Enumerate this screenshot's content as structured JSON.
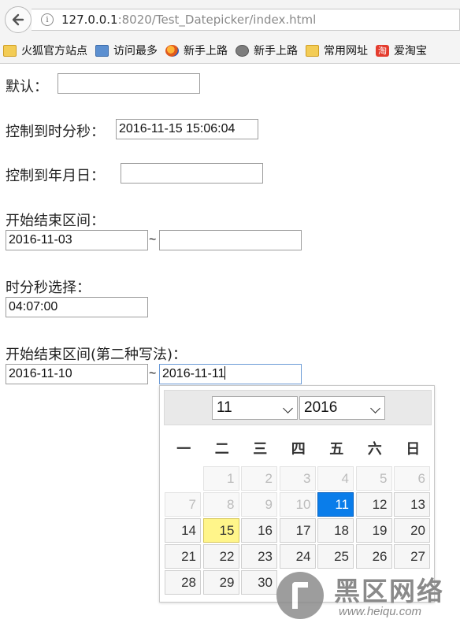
{
  "browser": {
    "url_host": "127.0.0.1",
    "url_rest": ":8020/Test_Datepicker/index.html",
    "info_glyph": "i",
    "bookmarks": [
      {
        "label": "火狐官方站点",
        "icon": "folder-icon"
      },
      {
        "label": "访问最多",
        "icon": "bookmark-book-icon"
      },
      {
        "label": "新手上路",
        "icon": "firefox-icon"
      },
      {
        "label": "新手上路",
        "icon": "globe-icon"
      },
      {
        "label": "常用网址",
        "icon": "folder-icon"
      },
      {
        "label": "爱淘宝",
        "icon": "taobao-icon",
        "glyph": "淘"
      }
    ]
  },
  "form": {
    "default_label": "默认：",
    "default_value": "",
    "datetime_label": "控制到时分秒：",
    "datetime_value": "2016-11-15 15:06:04",
    "date_label": "控制到年月日：",
    "date_value": "",
    "range_label": "开始结束区间：",
    "range_start": "2016-11-03",
    "range_end": "",
    "time_label": "时分秒选择：",
    "time_value": "04:07:00",
    "range2_label": "开始结束区间(第二种写法)：",
    "range2_start": "2016-11-10",
    "range2_end": "2016-11-11",
    "separator": "~"
  },
  "datepicker": {
    "month_value": "11",
    "year_value": "2016",
    "weekdays": [
      "一",
      "二",
      "三",
      "四",
      "五",
      "六",
      "日"
    ],
    "weeks": [
      [
        null,
        "1",
        "2",
        "3",
        "4",
        "5",
        "6"
      ],
      [
        "7",
        "8",
        "9",
        "10",
        "11",
        "12",
        "13"
      ],
      [
        "14",
        "15",
        "16",
        "17",
        "18",
        "19",
        "20"
      ],
      [
        "21",
        "22",
        "23",
        "24",
        "25",
        "26",
        "27"
      ],
      [
        "28",
        "29",
        "30",
        null,
        null,
        null,
        null
      ]
    ],
    "disabled_days": [
      "1",
      "2",
      "3",
      "4",
      "5",
      "6",
      "7",
      "8",
      "9",
      "10"
    ],
    "selected_day": "11",
    "today_day": "15",
    "colors": {
      "selected": "#0a7dea",
      "today": "#fff58a"
    }
  },
  "watermark": {
    "cn_text": "黑区网络",
    "url_text": "www.heiqu.com"
  }
}
